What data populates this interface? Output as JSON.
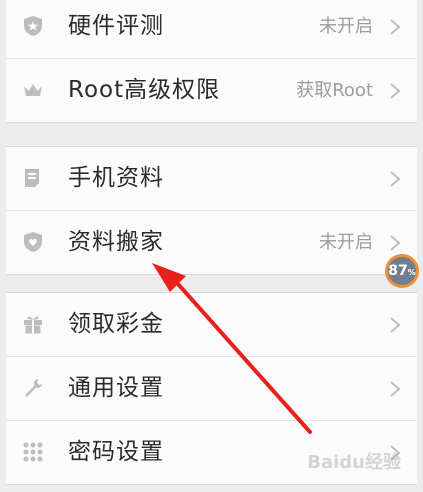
{
  "groups": [
    {
      "items": [
        {
          "label": "硬件评测",
          "status": "未开启",
          "icon": "shield-star-icon"
        },
        {
          "label": "Root高级权限",
          "status": "获取Root",
          "icon": "crown-icon"
        }
      ]
    },
    {
      "items": [
        {
          "label": "手机资料",
          "status": "",
          "icon": "document-icon"
        },
        {
          "label": "资料搬家",
          "status": "未开启",
          "icon": "shield-heart-icon"
        }
      ]
    },
    {
      "items": [
        {
          "label": "领取彩金",
          "status": "",
          "icon": "gift-icon"
        },
        {
          "label": "通用设置",
          "status": "",
          "icon": "wrench-icon"
        },
        {
          "label": "密码设置",
          "status": "",
          "icon": "grid-dots-icon"
        }
      ]
    }
  ],
  "badge": {
    "value": "87",
    "unit": "%"
  },
  "watermark": "Baidu经验",
  "colors": {
    "arrow": "#e8211d",
    "icon": "#bdbdbd",
    "text": "#2b2b2b",
    "status": "#9c9c9c"
  }
}
